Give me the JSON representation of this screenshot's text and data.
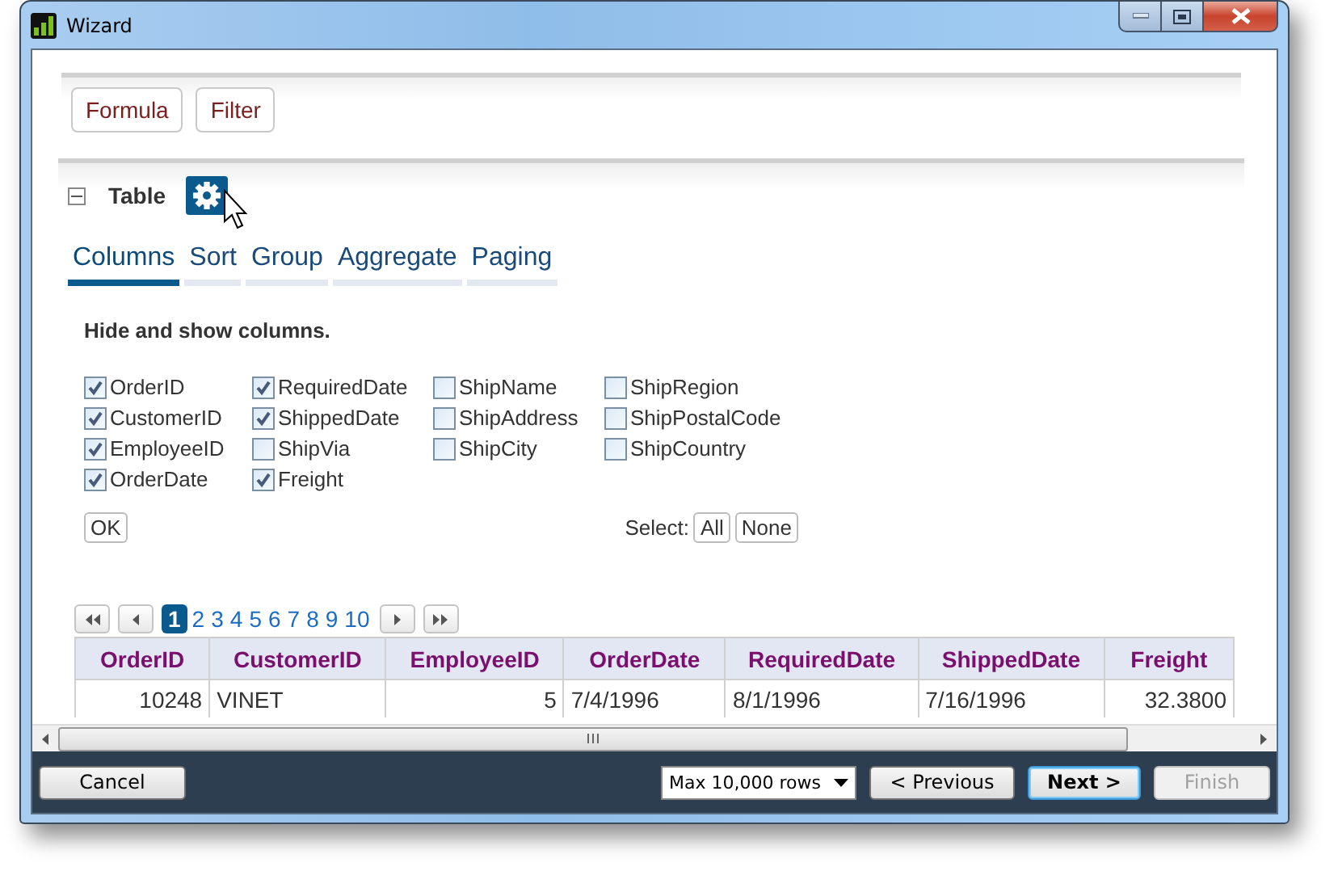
{
  "window": {
    "title": "Wizard"
  },
  "toolbar": {
    "buttons": [
      "Formula",
      "Filter"
    ]
  },
  "section": {
    "title": "Table",
    "expanded": true
  },
  "tabs": [
    {
      "label": "Columns",
      "selected": true
    },
    {
      "label": "Sort",
      "selected": false
    },
    {
      "label": "Group",
      "selected": false
    },
    {
      "label": "Aggregate",
      "selected": false
    },
    {
      "label": "Paging",
      "selected": false
    }
  ],
  "columns_panel": {
    "heading": "Hide and show columns.",
    "groups": [
      {
        "items": [
          {
            "label": "OrderID",
            "checked": true
          },
          {
            "label": "CustomerID",
            "checked": true
          },
          {
            "label": "EmployeeID",
            "checked": true
          },
          {
            "label": "OrderDate",
            "checked": true
          }
        ]
      },
      {
        "items": [
          {
            "label": "RequiredDate",
            "checked": true
          },
          {
            "label": "ShippedDate",
            "checked": true
          },
          {
            "label": "ShipVia",
            "checked": false
          },
          {
            "label": "Freight",
            "checked": true
          }
        ]
      },
      {
        "items": [
          {
            "label": "ShipName",
            "checked": false
          },
          {
            "label": "ShipAddress",
            "checked": false
          },
          {
            "label": "ShipCity",
            "checked": false
          }
        ]
      },
      {
        "items": [
          {
            "label": "ShipRegion",
            "checked": false
          },
          {
            "label": "ShipPostalCode",
            "checked": false
          },
          {
            "label": "ShipCountry",
            "checked": false
          }
        ]
      }
    ],
    "ok_button": "OK",
    "select_label": "Select:",
    "select_buttons": [
      "All",
      "None"
    ]
  },
  "pager": {
    "pages": [
      {
        "label": "1",
        "selected": true
      },
      {
        "label": "2",
        "selected": false
      },
      {
        "label": "3",
        "selected": false
      },
      {
        "label": "4",
        "selected": false
      },
      {
        "label": "5",
        "selected": false
      },
      {
        "label": "6",
        "selected": false
      },
      {
        "label": "7",
        "selected": false
      },
      {
        "label": "8",
        "selected": false
      },
      {
        "label": "9",
        "selected": false
      },
      {
        "label": "10",
        "selected": false
      }
    ]
  },
  "table": {
    "columns": [
      "OrderID",
      "CustomerID",
      "EmployeeID",
      "OrderDate",
      "RequiredDate",
      "ShippedDate",
      "Freight"
    ],
    "rows": [
      [
        {
          "text": "10248",
          "kind": "number"
        },
        {
          "text": "VINET",
          "kind": "text"
        },
        {
          "text": "5",
          "kind": "number"
        },
        {
          "text": "7/4/1996",
          "kind": "text"
        },
        {
          "text": "8/1/1996",
          "kind": "text"
        },
        {
          "text": "7/16/1996",
          "kind": "text"
        },
        {
          "text": "32.3800",
          "kind": "number"
        }
      ]
    ]
  },
  "footer": {
    "cancel": "Cancel",
    "row_limit": "Max 10,000 rows",
    "buttons": [
      {
        "label": "< Previous",
        "kind": "normal",
        "disabled": false
      },
      {
        "label": "Next >",
        "kind": "default",
        "disabled": false
      },
      {
        "label": "Finish",
        "kind": "normal",
        "disabled": true
      }
    ]
  }
}
